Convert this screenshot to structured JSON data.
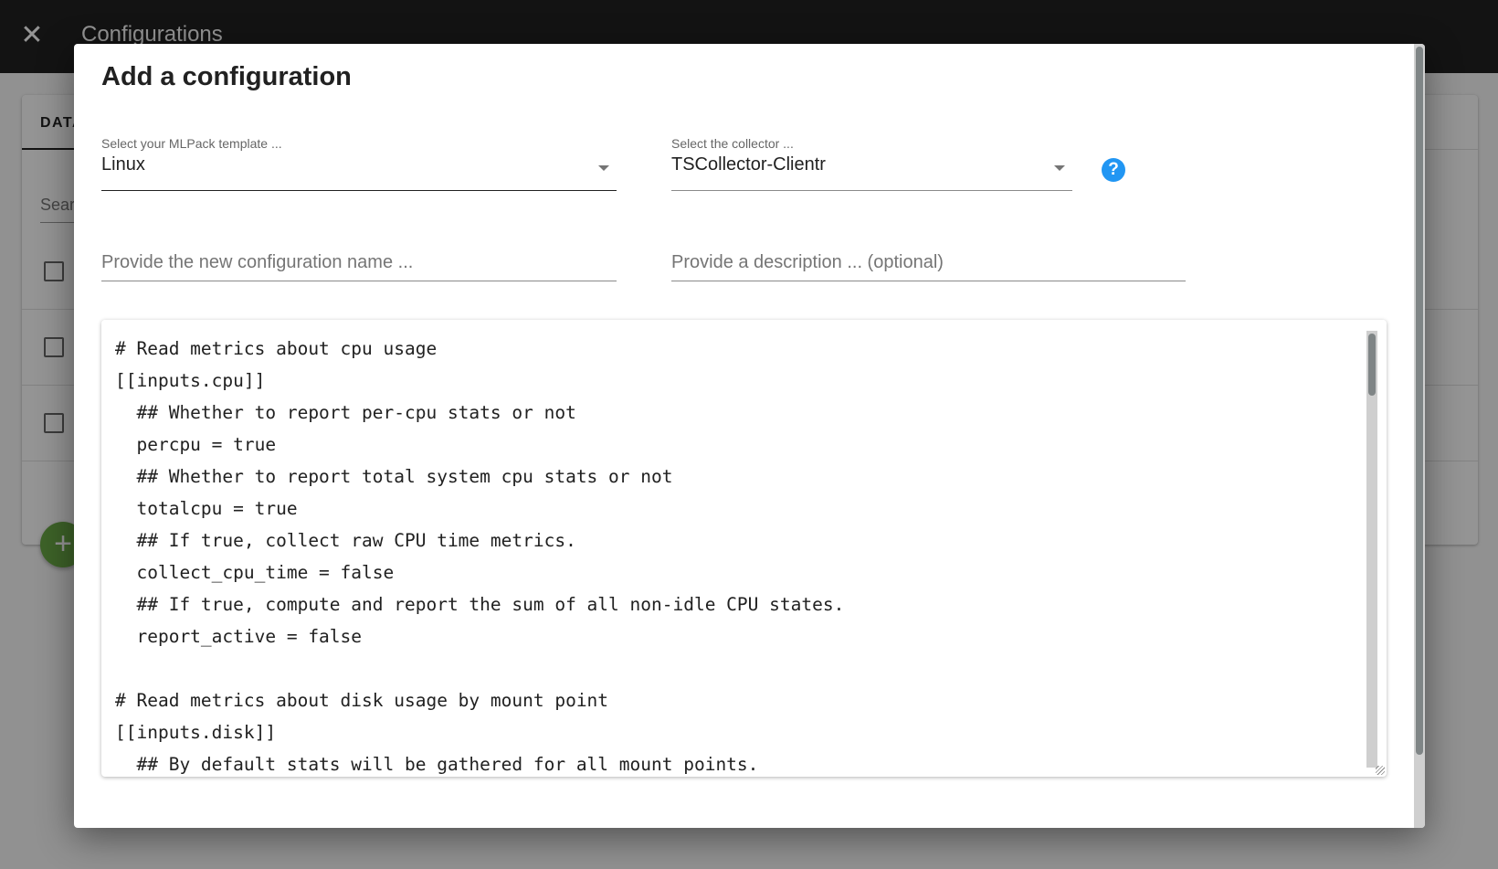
{
  "page": {
    "title": "Configurations",
    "close_icon": "close-icon",
    "tab_label": "DATA",
    "search_placeholder": "Search",
    "row_count": 3,
    "fab_icon": "plus-icon",
    "pager_next_icon": "chevron-right-icon"
  },
  "modal": {
    "title": "Add a configuration",
    "template_select": {
      "label": "Select your MLPack template ...",
      "value": "Linux"
    },
    "collector_select": {
      "label": "Select the collector ...",
      "value": "TSCollector-Clientr"
    },
    "help_icon": "?",
    "name_input": {
      "value": "",
      "placeholder": "Provide the new configuration name ..."
    },
    "description_input": {
      "value": "",
      "placeholder": "Provide a description ... (optional)"
    },
    "config_text": "# Read metrics about cpu usage\n[[inputs.cpu]]\n  ## Whether to report per-cpu stats or not\n  percpu = true\n  ## Whether to report total system cpu stats or not\n  totalcpu = true\n  ## If true, collect raw CPU time metrics.\n  collect_cpu_time = false\n  ## If true, compute and report the sum of all non-idle CPU states.\n  report_active = false\n\n# Read metrics about disk usage by mount point\n[[inputs.disk]]\n  ## By default stats will be gathered for all mount points."
  },
  "colors": {
    "appbar": "#212121",
    "help_accent": "#2196f3",
    "fab": "#6aaa46"
  }
}
